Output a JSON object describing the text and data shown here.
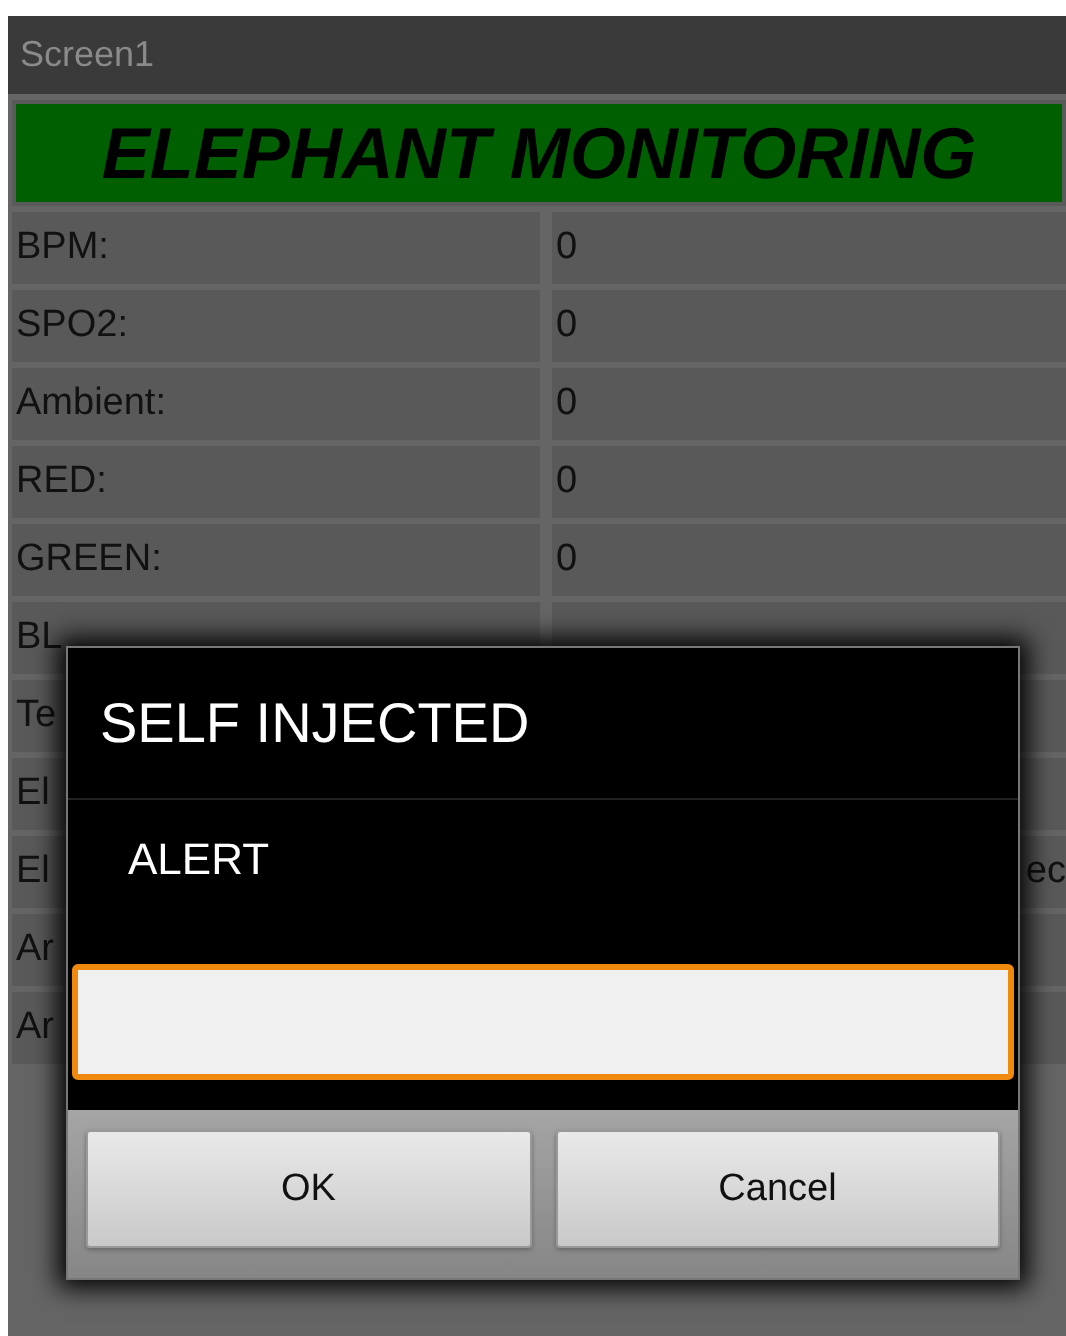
{
  "window": {
    "title": "Screen1"
  },
  "banner": {
    "text": "ELEPHANT MONITORING"
  },
  "rows": [
    {
      "label": "BPM:",
      "value": "0"
    },
    {
      "label": "SPO2:",
      "value": "0"
    },
    {
      "label": "Ambient:",
      "value": "0"
    },
    {
      "label": "RED:",
      "value": "0"
    },
    {
      "label": "GREEN:",
      "value": "0"
    }
  ],
  "rows_under_dialog": [
    {
      "label": "BL"
    },
    {
      "label": "Te"
    },
    {
      "label": "El"
    },
    {
      "label": "El",
      "value": "ec"
    },
    {
      "label": "Ar"
    },
    {
      "label": "Ar"
    }
  ],
  "dialog": {
    "title": "SELF INJECTED",
    "message": "ALERT",
    "buttons": [
      "OK",
      "Cancel"
    ]
  }
}
